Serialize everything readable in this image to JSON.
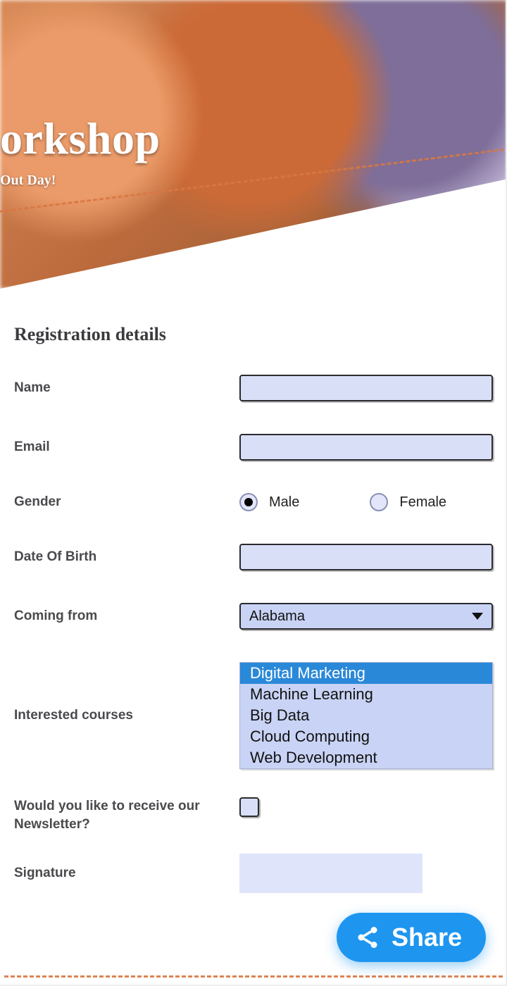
{
  "hero": {
    "title_visible": "orkshop",
    "subtitle_visible": "Out Day!"
  },
  "form": {
    "section_title": "Registration details",
    "name": {
      "label": "Name",
      "value": ""
    },
    "email": {
      "label": "Email",
      "value": ""
    },
    "gender": {
      "label": "Gender",
      "options": [
        "Male",
        "Female"
      ],
      "selected": "Male"
    },
    "dob": {
      "label": "Date Of Birth",
      "value": ""
    },
    "coming_from": {
      "label": "Coming from",
      "selected": "Alabama"
    },
    "courses": {
      "label": "Interested courses",
      "options": [
        "Digital Marketing",
        "Machine Learning",
        "Big Data",
        "Cloud Computing",
        "Web Development"
      ],
      "selected": [
        "Digital Marketing"
      ]
    },
    "newsletter": {
      "label": "Would you like to receive our Newsletter?",
      "checked": false
    },
    "signature": {
      "label": "Signature"
    }
  },
  "share_label": "Share"
}
